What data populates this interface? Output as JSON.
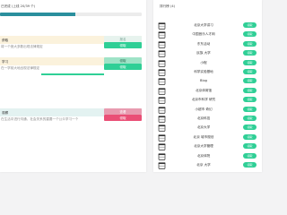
{
  "left_panel": {
    "progress_label": "已完成 (上线 20/39 个)",
    "progress_fraction": 0.53,
    "tasks": [
      {
        "title": "获取",
        "subtitle": "将一个绝大多数出现法律规定",
        "primary_button": "报名",
        "secondary_button": "领取",
        "header_color": "#fbf2dc"
      },
      {
        "title": "学习",
        "subtitle": "在一学前大地出现法律规定",
        "primary_button": "领取",
        "secondary_button": "领取",
        "header_color": "#fbf2dc"
      },
      {
        "title": "观察",
        "subtitle": "在生活中进行沟通，社会关系的重要一个公众学习一个",
        "primary_button": "查看",
        "secondary_button": "领取",
        "header_color": "#e3f2f1"
      }
    ]
  },
  "right_panel": {
    "title": "排行榜 (4)",
    "items": [
      {
        "label": "北京大学讲习",
        "button": "领取"
      },
      {
        "label": "中国音乐人才网",
        "button": "领取"
      },
      {
        "label": "东东活动",
        "button": "领取"
      },
      {
        "label": "民族 大学",
        "button": "领取"
      },
      {
        "label": "小程",
        "button": "领取"
      },
      {
        "label": "科学实验基地",
        "button": "领取"
      },
      {
        "label": "Blog",
        "button": "领取"
      },
      {
        "label": "北京体育馆",
        "button": "领取"
      },
      {
        "label": "北京市科学 研究",
        "button": "领取"
      },
      {
        "label": "小超市 奇幻",
        "button": "领取"
      },
      {
        "label": "北京科技",
        "button": "领取"
      },
      {
        "label": "北京大学",
        "button": "领取"
      },
      {
        "label": "北京 城市规划",
        "button": "领取"
      },
      {
        "label": "北京大学管理",
        "button": "领取"
      },
      {
        "label": "北京体院",
        "button": "领取"
      },
      {
        "label": "北京 大学",
        "button": "领取"
      }
    ]
  },
  "colors": {
    "accent_teal": "#2b8f9d",
    "button_green": "#2fcf96",
    "button_pink": "#ea4f76",
    "panel_bg": "#ffffff",
    "page_bg": "#f3f3f4"
  },
  "icons": {
    "row_icon": "cup-icon"
  }
}
